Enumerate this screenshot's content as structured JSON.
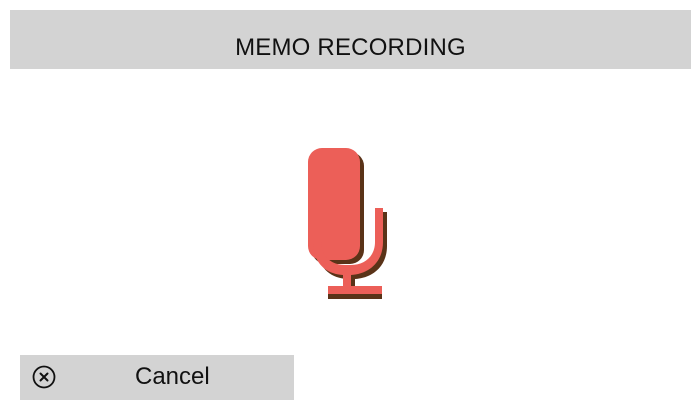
{
  "title": "MEMO RECORDING",
  "center_icon": "microphone-icon",
  "cancel": {
    "label": "Cancel",
    "icon": "close-circle-icon"
  },
  "colors": {
    "title_bar_bg": "#d3d3d3",
    "mic_fill": "#ec5f58",
    "mic_shadow": "#5a3318",
    "button_bg": "#d3d3d3"
  }
}
